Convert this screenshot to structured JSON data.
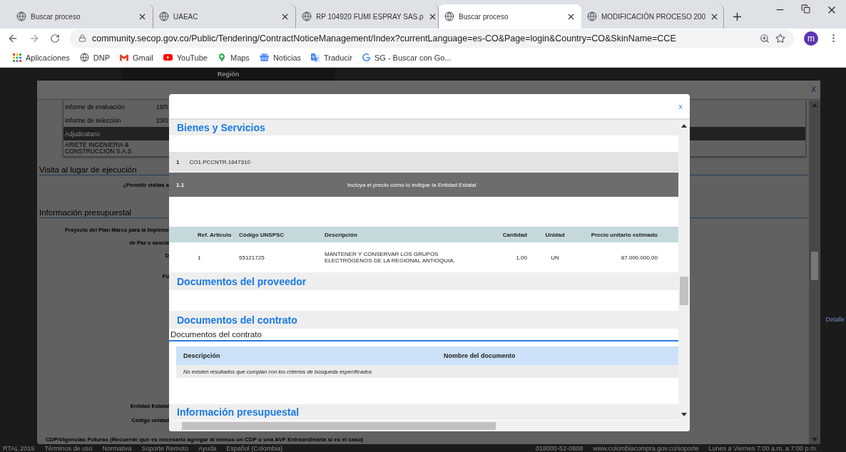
{
  "browser": {
    "tabs": [
      {
        "title": "Buscar proceso",
        "selected": false
      },
      {
        "title": "UAEAC",
        "selected": false
      },
      {
        "title": "RP 104920 FUMI ESPRAY SAS.p",
        "selected": false
      },
      {
        "title": "Buscar proceso",
        "selected": true
      },
      {
        "title": "MODIFICACIÓN PROCESO 200",
        "selected": false
      }
    ],
    "url": "community.secop.gov.co/Public/Tendering/ContractNoticeManagement/Index?currentLanguage=es-CO&Page=login&Country=CO&SkinName=CCE",
    "profile_initial": "m",
    "bookmarks": [
      {
        "label": "Aplicaciones",
        "kind": "apps"
      },
      {
        "label": "DNP",
        "kind": "globe"
      },
      {
        "label": "Gmail",
        "kind": "gmail"
      },
      {
        "label": "YouTube",
        "kind": "youtube"
      },
      {
        "label": "Maps",
        "kind": "maps"
      },
      {
        "label": "Noticias",
        "kind": "news"
      },
      {
        "label": "Traducir",
        "kind": "translate"
      },
      {
        "label": "SG - Buscar con Go...",
        "kind": "google"
      }
    ]
  },
  "background_page": {
    "top_label": "Región",
    "close_label": "X",
    "schedule": [
      {
        "label": "Informe de evaluación",
        "date": "18/0",
        "selected": false
      },
      {
        "label": "Informe de selección",
        "date": "23/0",
        "selected": false
      },
      {
        "label": "Adjudicatario",
        "selected": true
      }
    ],
    "awardee": "ARIETE INGENIERIA & CONSTRUCCION S.A.S",
    "visit_section": {
      "title": "Visita al lugar de ejecución",
      "fields": [
        "¿Permitir visitas a"
      ]
    },
    "budget_section": {
      "title": "Información presupuestal",
      "fields": [
        "Proyecto del Plan Marco para la Impleme",
        "de Paz o asocia",
        "D",
        "Fu"
      ],
      "lower_fields": [
        "Entidad Estatal",
        "Código unidad"
      ]
    },
    "cdp_note": "CDP/Vigencias Futuras (Recuerde que es necesario agregar al menos un CDP o una AVF Extraordinaria si es el caso)",
    "side_link": "Detalle",
    "footer_left": [
      "RTAL 2019",
      "Términos de uso",
      "Normativa",
      "Soporte Remoto",
      "Ayuda",
      "Español (Colombia)"
    ],
    "footer_right": [
      "018000-52-0808",
      "www.colombiacompra.gov.co/soporte",
      "Lunes a Viernes 7:00 a.m. a 7:00 p.m."
    ]
  },
  "modal": {
    "close_label": "x",
    "goods_section": {
      "title": "Bienes y Servicios",
      "line": {
        "number": "1",
        "code": "CO1.PCCNTR.1647310"
      },
      "subline": {
        "number": "1.1",
        "note": "Incluya el precio como lo indique la Entidad Estatal"
      },
      "table": {
        "columns": [
          "Ref. Artículo",
          "Código UNSPSC",
          "Descripción",
          "Cantidad",
          "Unidad",
          "Precio unitario estimado"
        ],
        "rows": [
          [
            "1",
            "55121725",
            "MANTENER Y CONSERVAR LOS GRUPOS ELECTRÓGENOS DE LA REGIONAL ANTIOQUIA.",
            "1,00",
            "UN",
            "87.000.000,00"
          ]
        ]
      }
    },
    "supplier_docs": {
      "title": "Documentos del proveedor"
    },
    "contract_docs": {
      "title": "Documentos del contrato",
      "caption": "Documentos del contrato",
      "columns": [
        "Descripción",
        "Nombre del documento"
      ],
      "empty_message": "No existen resultados que cumplan con los criterios de búsqueda especificados"
    },
    "budget": {
      "title": "Información presupuestal"
    }
  }
}
